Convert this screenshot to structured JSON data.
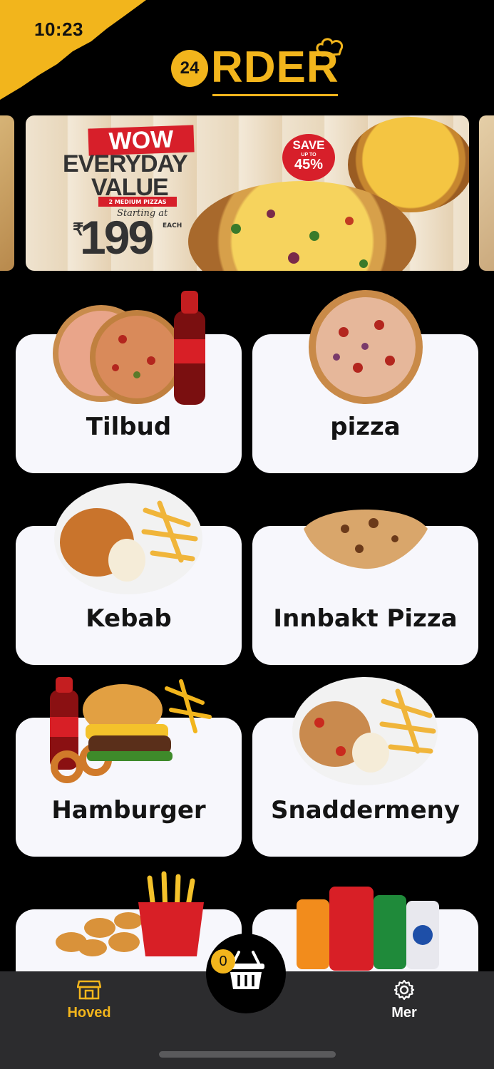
{
  "status_bar": {
    "time": "10:23"
  },
  "logo": {
    "badge": "24",
    "text": "RDER"
  },
  "banner": {
    "headline": "WOW",
    "line1": "EVERYDAY",
    "line2": "VALUE",
    "subline": "2 MEDIUM PIZZAS",
    "starting": "Starting at",
    "currency": "₹",
    "price": "199",
    "unit": "EACH",
    "save_label": "SAVE",
    "save_upto": "UP TO",
    "save_percent": "45%"
  },
  "categories": [
    {
      "label": "Tilbud",
      "image": "pizzas-and-cola"
    },
    {
      "label": "pizza",
      "image": "pizza"
    },
    {
      "label": "Kebab",
      "image": "kebab-plate-with-fries"
    },
    {
      "label": "Innbakt Pizza",
      "image": "calzone"
    },
    {
      "label": "Hamburger",
      "image": "burger-onion-rings-cola"
    },
    {
      "label": "Snaddermeny",
      "image": "chicken-plate-with-fries"
    },
    {
      "label": "",
      "image": "nuggets-and-fries"
    },
    {
      "label": "",
      "image": "soft-drink-cans"
    }
  ],
  "nav": {
    "home_label": "Hoved",
    "home_icon": "store-icon",
    "cart_count": "0",
    "cart_icon": "basket-icon",
    "more_label": "Mer",
    "more_icon": "gear-icon"
  },
  "colors": {
    "accent": "#f2b51c",
    "background": "#000000",
    "card": "#f7f7fc",
    "nav": "#2c2c2e",
    "banner_red": "#d71f2a"
  }
}
